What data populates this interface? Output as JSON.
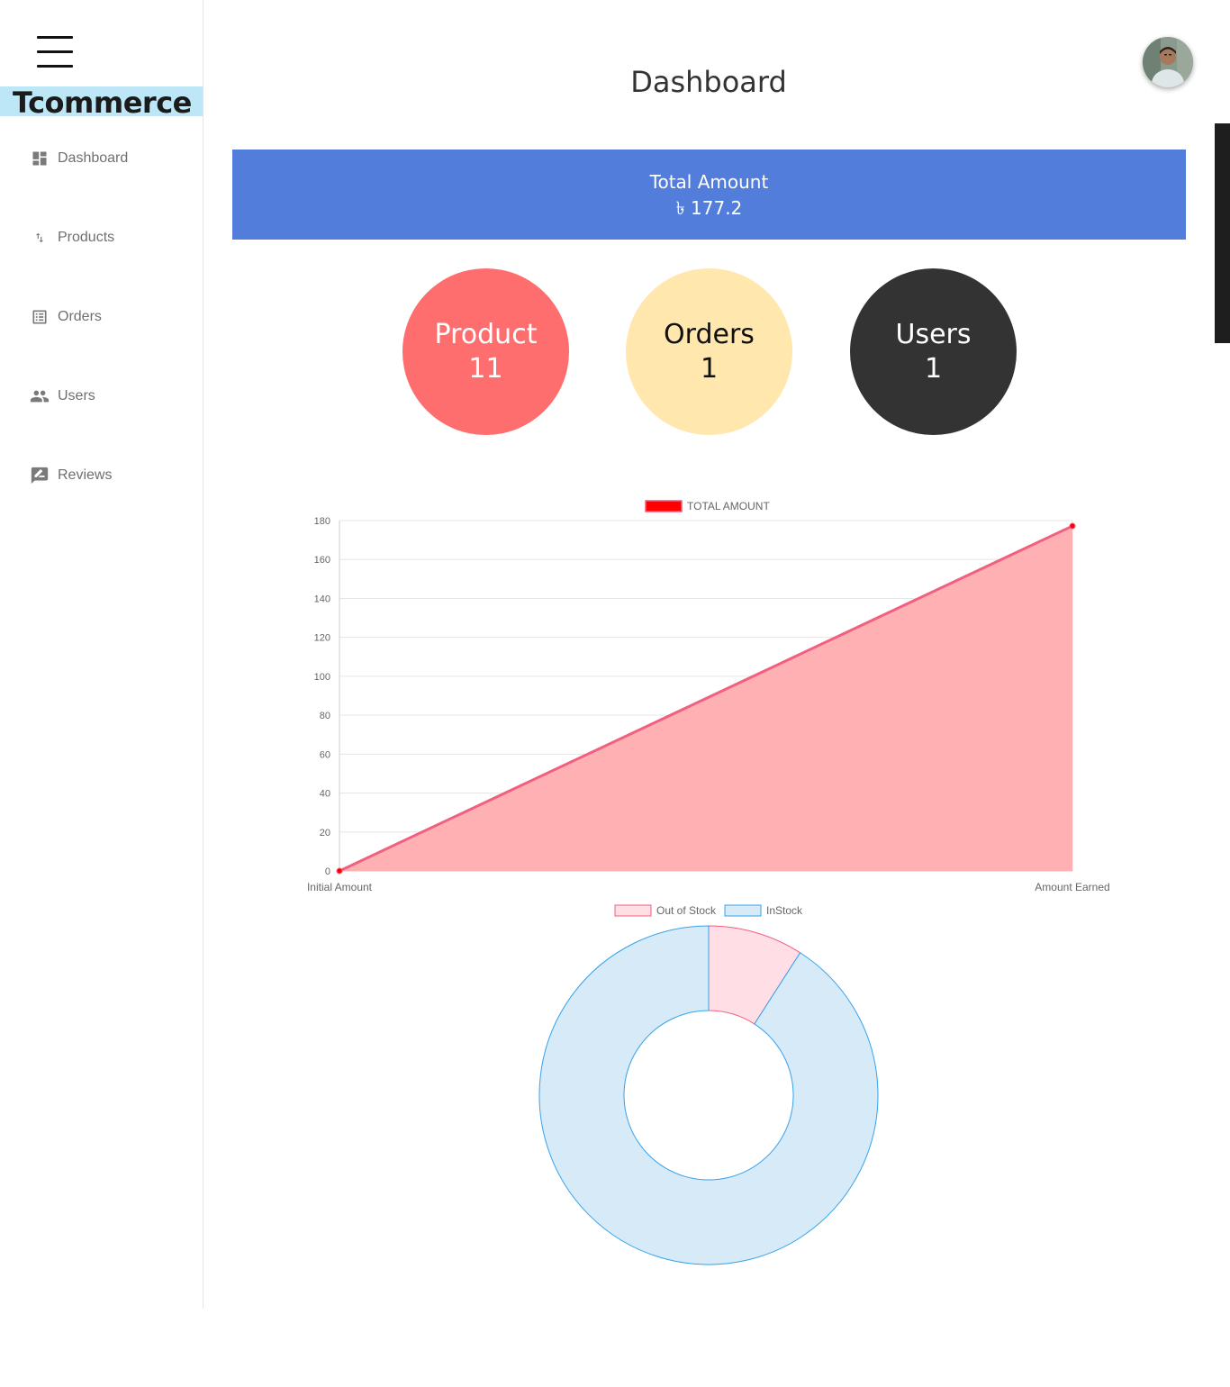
{
  "sidebar": {
    "brand": "Tcommerce",
    "items": [
      {
        "label": "Dashboard",
        "icon": "dashboard-icon"
      },
      {
        "label": "Products",
        "icon": "import-export-icon"
      },
      {
        "label": "Orders",
        "icon": "list-alt-icon"
      },
      {
        "label": "Users",
        "icon": "people-icon"
      },
      {
        "label": "Reviews",
        "icon": "rate-review-icon"
      }
    ]
  },
  "header": {
    "title": "Dashboard",
    "avatar_icon": "user-avatar"
  },
  "summary": {
    "total_label": "Total Amount",
    "total_value": "৳ 177.2",
    "cards": [
      {
        "label": "Product",
        "value": "11",
        "color": "#ff6e6e",
        "text_color": "#ffffff"
      },
      {
        "label": "Orders",
        "value": "1",
        "color": "#ffe7ae",
        "text_color": "#111111"
      },
      {
        "label": "Users",
        "value": "1",
        "color": "#333333",
        "text_color": "#ffffff"
      }
    ]
  },
  "colors": {
    "banner": "#527ddb",
    "line": "#f25f7f",
    "area_fill": "#ffb0b2",
    "point": "#ff0000",
    "out_of_stock": "#ffdfe5",
    "in_stock": "#d6eaf7",
    "in_stock_border": "#36a2eb"
  },
  "chart_data": [
    {
      "type": "area",
      "legend": [
        "TOTAL AMOUNT"
      ],
      "legend_position": "top",
      "categories": [
        "Initial Amount",
        "Amount Earned"
      ],
      "series": [
        {
          "name": "TOTAL AMOUNT",
          "values": [
            0,
            177.2
          ]
        }
      ],
      "ylim": [
        0,
        180
      ],
      "yticks": [
        0,
        20,
        40,
        60,
        80,
        100,
        120,
        140,
        160,
        180
      ],
      "grid": true
    },
    {
      "type": "pie",
      "donut": true,
      "legend": [
        "Out of Stock",
        "InStock"
      ],
      "legend_position": "top",
      "labels": [
        "Out of Stock",
        "InStock"
      ],
      "values": [
        1,
        10
      ]
    }
  ]
}
